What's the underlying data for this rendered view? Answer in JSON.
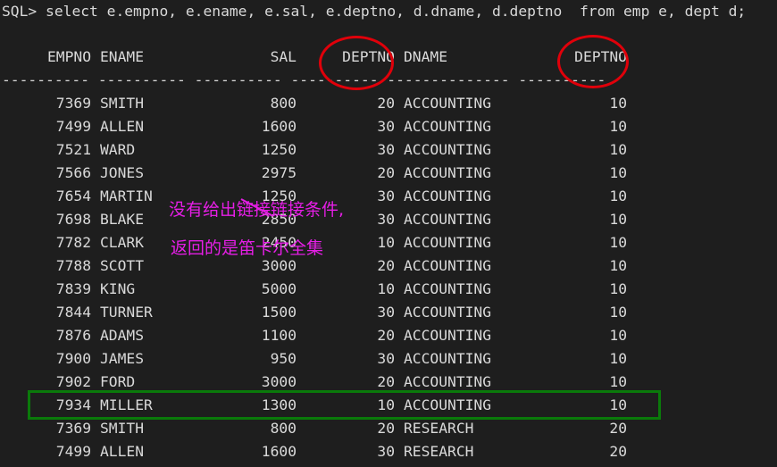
{
  "command": {
    "prompt": "SQL>",
    "query": "select e.empno, e.ename, e.sal, e.deptno, d.dname, d.deptno  from emp e, dept d;"
  },
  "columns": [
    "EMPNO",
    "ENAME",
    "SAL",
    "DEPTNO",
    "DNAME",
    "DEPTNO"
  ],
  "separator": "---------- ---------- ---------- ---------- -------------- ----------",
  "rows": [
    {
      "empno": "7369",
      "ename": "SMITH",
      "sal": "800",
      "deptno": "20",
      "dname": "ACCOUNTING",
      "d_deptno": "10"
    },
    {
      "empno": "7499",
      "ename": "ALLEN",
      "sal": "1600",
      "deptno": "30",
      "dname": "ACCOUNTING",
      "d_deptno": "10"
    },
    {
      "empno": "7521",
      "ename": "WARD",
      "sal": "1250",
      "deptno": "30",
      "dname": "ACCOUNTING",
      "d_deptno": "10"
    },
    {
      "empno": "7566",
      "ename": "JONES",
      "sal": "2975",
      "deptno": "20",
      "dname": "ACCOUNTING",
      "d_deptno": "10"
    },
    {
      "empno": "7654",
      "ename": "MARTIN",
      "sal": "1250",
      "deptno": "30",
      "dname": "ACCOUNTING",
      "d_deptno": "10"
    },
    {
      "empno": "7698",
      "ename": "BLAKE",
      "sal": "2850",
      "deptno": "30",
      "dname": "ACCOUNTING",
      "d_deptno": "10"
    },
    {
      "empno": "7782",
      "ename": "CLARK",
      "sal": "2450",
      "deptno": "10",
      "dname": "ACCOUNTING",
      "d_deptno": "10"
    },
    {
      "empno": "7788",
      "ename": "SCOTT",
      "sal": "3000",
      "deptno": "20",
      "dname": "ACCOUNTING",
      "d_deptno": "10"
    },
    {
      "empno": "7839",
      "ename": "KING",
      "sal": "5000",
      "deptno": "10",
      "dname": "ACCOUNTING",
      "d_deptno": "10"
    },
    {
      "empno": "7844",
      "ename": "TURNER",
      "sal": "1500",
      "deptno": "30",
      "dname": "ACCOUNTING",
      "d_deptno": "10"
    },
    {
      "empno": "7876",
      "ename": "ADAMS",
      "sal": "1100",
      "deptno": "20",
      "dname": "ACCOUNTING",
      "d_deptno": "10"
    },
    {
      "empno": "7900",
      "ename": "JAMES",
      "sal": "950",
      "deptno": "30",
      "dname": "ACCOUNTING",
      "d_deptno": "10"
    },
    {
      "empno": "7902",
      "ename": "FORD",
      "sal": "3000",
      "deptno": "20",
      "dname": "ACCOUNTING",
      "d_deptno": "10"
    },
    {
      "empno": "7934",
      "ename": "MILLER",
      "sal": "1300",
      "deptno": "10",
      "dname": "ACCOUNTING",
      "d_deptno": "10"
    },
    {
      "empno": "7369",
      "ename": "SMITH",
      "sal": "800",
      "deptno": "20",
      "dname": "RESEARCH",
      "d_deptno": "20"
    },
    {
      "empno": "7499",
      "ename": "ALLEN",
      "sal": "1600",
      "deptno": "30",
      "dname": "RESEARCH",
      "d_deptno": "20"
    }
  ],
  "annotations": {
    "line1": "没有给出链接链接条件,",
    "line2": "返回的是笛卡尔全集",
    "highlight_row": "7934 MILLER",
    "colors": {
      "note": "#e61ee6",
      "ellipse": "#e0000a",
      "highlight_box": "#0a7a0a"
    }
  },
  "theme": {
    "background": "#1e1e1e",
    "text": "#d9d9d9"
  }
}
